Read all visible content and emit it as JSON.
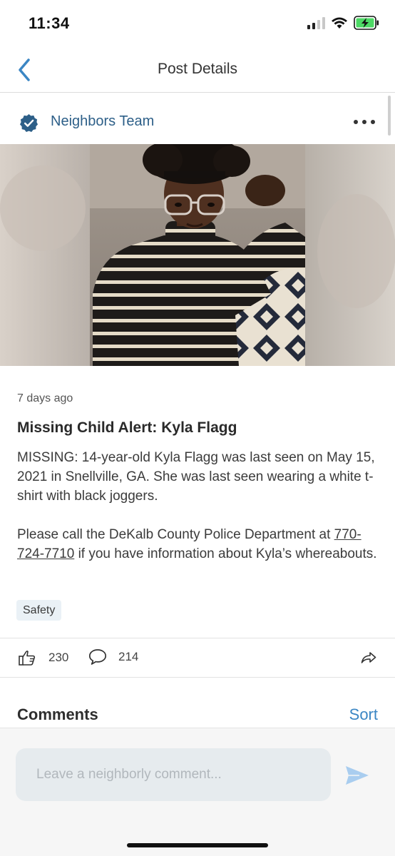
{
  "status_bar": {
    "time": "11:34",
    "icons": [
      "cellular-signal-icon",
      "wifi-icon",
      "battery-charging-icon"
    ],
    "battery_color": "#4cd964"
  },
  "header": {
    "back_icon": "chevron-left-icon",
    "title": "Post Details",
    "accent_color": "#3b86c4"
  },
  "author": {
    "name": "Neighbors Team",
    "verified_icon": "verified-badge-icon",
    "name_color": "#2d5f88",
    "menu_icon": "more-horizontal-icon"
  },
  "post": {
    "time_ago": "7 days ago",
    "title": "Missing Child Alert: Kyla Flagg",
    "body_paragraph_1": "MISSING: 14-year-old Kyla Flagg was last seen on May 15, 2021 in Snellville, GA. She was last seen wearing a white t-shirt with black joggers.",
    "body_paragraph_2_prefix": "Please call the DeKalb County Police Department at ",
    "phone": "770-724-7710",
    "body_paragraph_2_suffix": " if you have information about Kyla’s whereabouts.",
    "tag": "Safety"
  },
  "actions": {
    "like_icon": "thumbs-up-icon",
    "like_count": "230",
    "comment_icon": "speech-bubble-icon",
    "comment_count": "214",
    "share_icon": "share-arrow-icon"
  },
  "comments": {
    "title": "Comments",
    "sort_label": "Sort"
  },
  "composer": {
    "placeholder": "Leave a neighborly comment...",
    "send_icon": "send-icon"
  }
}
